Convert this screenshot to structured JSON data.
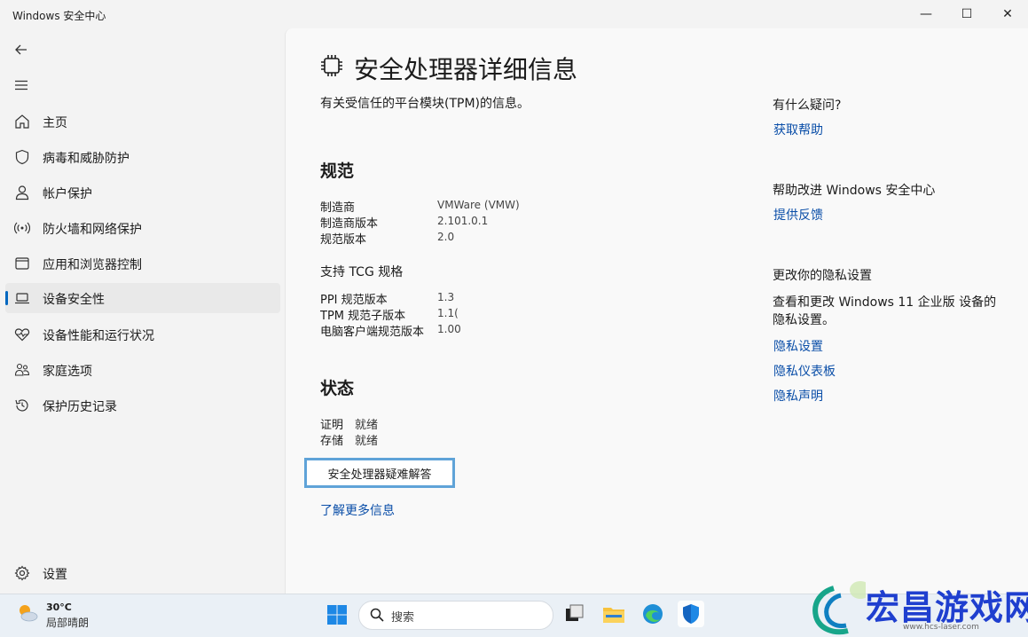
{
  "window": {
    "title": "Windows 安全中心",
    "minimize": "—",
    "maximize": "☐",
    "close": "✕"
  },
  "sidebar": {
    "items": [
      {
        "label": "主页",
        "icon": "home-icon"
      },
      {
        "label": "病毒和威胁防护",
        "icon": "shield-icon"
      },
      {
        "label": "帐户保护",
        "icon": "person-icon"
      },
      {
        "label": "防火墙和网络保护",
        "icon": "wifi-signal-icon"
      },
      {
        "label": "应用和浏览器控制",
        "icon": "app-window-icon"
      },
      {
        "label": "设备安全性",
        "icon": "laptop-icon",
        "selected": true
      },
      {
        "label": "设备性能和运行状况",
        "icon": "heart-pulse-icon"
      },
      {
        "label": "家庭选项",
        "icon": "family-icon"
      },
      {
        "label": "保护历史记录",
        "icon": "history-icon"
      }
    ],
    "settings_label": "设置"
  },
  "main": {
    "title": "安全处理器详细信息",
    "description": "有关受信任的平台模块(TPM)的信息。",
    "spec": {
      "heading": "规范",
      "rows": [
        {
          "key": "制造商",
          "value": "VMWare (VMW)"
        },
        {
          "key": "制造商版本",
          "value": "2.101.0.1"
        },
        {
          "key": "规范版本",
          "value": "2.0"
        }
      ]
    },
    "tcg": {
      "heading": "支持 TCG 规格",
      "rows": [
        {
          "key": "PPI 规范版本",
          "value": "1.3"
        },
        {
          "key": "TPM 规范子版本",
          "value": "1.1("
        },
        {
          "key": "电脑客户端规范版本",
          "value": "1.00"
        }
      ]
    },
    "status": {
      "heading": "状态",
      "rows": [
        {
          "key": "证明",
          "value": "就绪"
        },
        {
          "key": "存储",
          "value": "就绪"
        }
      ]
    },
    "troubleshoot_button": "安全处理器疑难解答",
    "learn_more_link": "了解更多信息"
  },
  "right": {
    "help_heading": "有什么疑问?",
    "help_link": "获取帮助",
    "improve_heading": "帮助改进 Windows 安全中心",
    "feedback_link": "提供反馈",
    "privacy_heading": "更改你的隐私设置",
    "privacy_text": "查看和更改 Windows 11 企业版 设备的隐私设置。",
    "privacy_links": [
      "隐私设置",
      "隐私仪表板",
      "隐私声明"
    ]
  },
  "taskbar": {
    "weather_temp": "30°C",
    "weather_condition": "局部晴朗",
    "search_placeholder": "搜索"
  },
  "watermark": {
    "text": "宏昌游戏网",
    "url": "www.hcs-laser.com"
  }
}
